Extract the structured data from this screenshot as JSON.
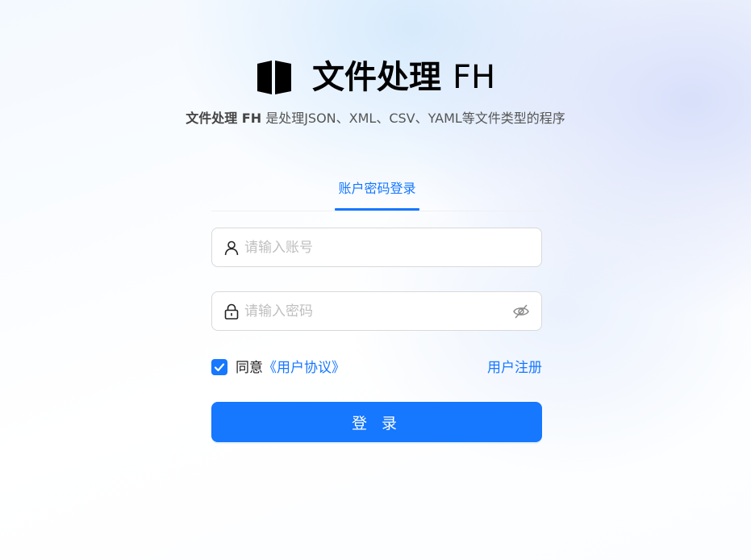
{
  "app": {
    "title_cn": "文件处理",
    "title_en": "FH",
    "subtitle_brand": "文件处理 FH",
    "subtitle_text": " 是处理JSON、XML、CSV、YAML等文件类型的程序",
    "logo_icon": "book-open-icon"
  },
  "tabs": [
    {
      "label": "账户密码登录",
      "active": true
    }
  ],
  "form": {
    "username": {
      "value": "",
      "placeholder": "请输入账号",
      "icon": "user-icon"
    },
    "password": {
      "value": "",
      "placeholder": "请输入密码",
      "icon": "lock-icon",
      "toggle_icon": "eye-invisible-icon"
    },
    "agree": {
      "checked": true,
      "prefix": "同意",
      "link": "《用户协议》"
    },
    "register_label": "用户注册",
    "submit_label": "登 录"
  },
  "colors": {
    "primary": "#1677ff",
    "placeholder": "#bfbfbf",
    "border": "#d9d9d9"
  }
}
